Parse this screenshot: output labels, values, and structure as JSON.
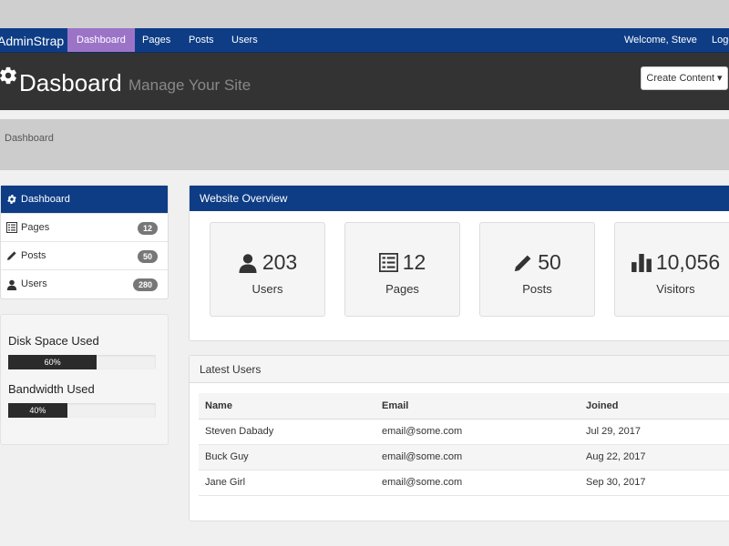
{
  "navbar": {
    "brand": "AdminStrap",
    "items": [
      {
        "label": "Dashboard",
        "active": true
      },
      {
        "label": "Pages"
      },
      {
        "label": "Posts"
      },
      {
        "label": "Users"
      }
    ],
    "welcome": "Welcome, Steve",
    "logout": "Logo"
  },
  "header": {
    "title": "Dasboard",
    "subtitle": "Manage Your Site",
    "create_button": "Create Content ▾"
  },
  "breadcrumb": "Dashboard",
  "sidebar": {
    "items": [
      {
        "label": "Dashboard",
        "icon": "gear-icon",
        "active": true
      },
      {
        "label": "Pages",
        "icon": "list-icon",
        "badge": "12"
      },
      {
        "label": "Posts",
        "icon": "pencil-icon",
        "badge": "50"
      },
      {
        "label": "Users",
        "icon": "user-icon",
        "badge": "280"
      }
    ]
  },
  "usage": {
    "disk_label": "Disk Space Used",
    "disk_value": "60%",
    "disk_fraction": 0.6,
    "bandwidth_label": "Bandwidth Used",
    "bandwidth_value": "40%",
    "bandwidth_fraction": 0.4
  },
  "overview": {
    "title": "Website Overview",
    "stats": [
      {
        "value": "203",
        "label": "Users",
        "icon": "user-icon"
      },
      {
        "value": "12",
        "label": "Pages",
        "icon": "list-icon"
      },
      {
        "value": "50",
        "label": "Posts",
        "icon": "pencil-icon"
      },
      {
        "value": "10,056",
        "label": "Visitors",
        "icon": "bar-chart-icon"
      }
    ]
  },
  "latest_users": {
    "title": "Latest Users",
    "columns": [
      "Name",
      "Email",
      "Joined"
    ],
    "rows": [
      [
        "Steven Dabady",
        "email@some.com",
        "Jul 29, 2017"
      ],
      [
        "Buck Guy",
        "email@some.com",
        "Aug 22, 2017"
      ],
      [
        "Jane Girl",
        "email@some.com",
        "Sep 30, 2017"
      ]
    ]
  },
  "colors": {
    "navbar": "#0e3d86",
    "active_nav": "#9b74c8",
    "header": "#333333"
  }
}
